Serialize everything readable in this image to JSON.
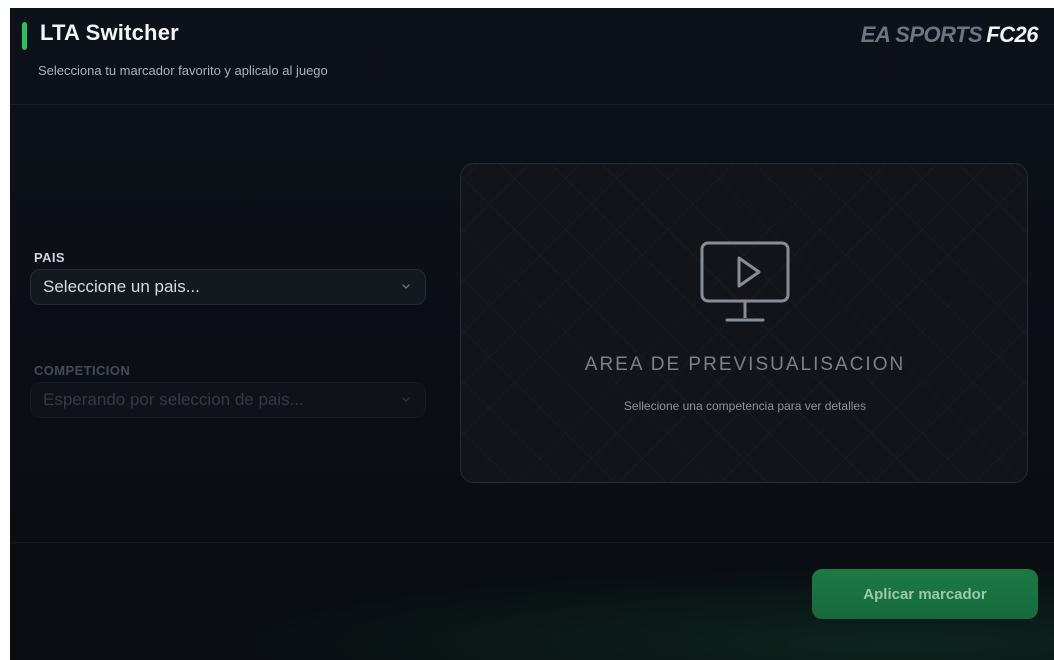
{
  "header": {
    "title": "LTA Switcher",
    "subtitle": "Selecciona tu marcador favorito y aplicalo al juego",
    "brand_ea": "EA SPORTS",
    "brand_fc": "FC26",
    "accent_color": "#22c55e"
  },
  "form": {
    "pais": {
      "label": "PAIS",
      "value": "Seleccione un pais...",
      "icon": "chevron-down-icon"
    },
    "competicion": {
      "label": "COMPETICION",
      "value": "Esperando por seleccion de pais...",
      "icon": "chevron-down-icon",
      "disabled": true
    }
  },
  "preview": {
    "icon": "monitor-play-icon",
    "title": "AREA DE PREVISUALISACION",
    "hint": "Sellecione una competencia para ver detalles"
  },
  "footer": {
    "apply_label": "Aplicar marcador",
    "button_color": "#1c7a45"
  }
}
